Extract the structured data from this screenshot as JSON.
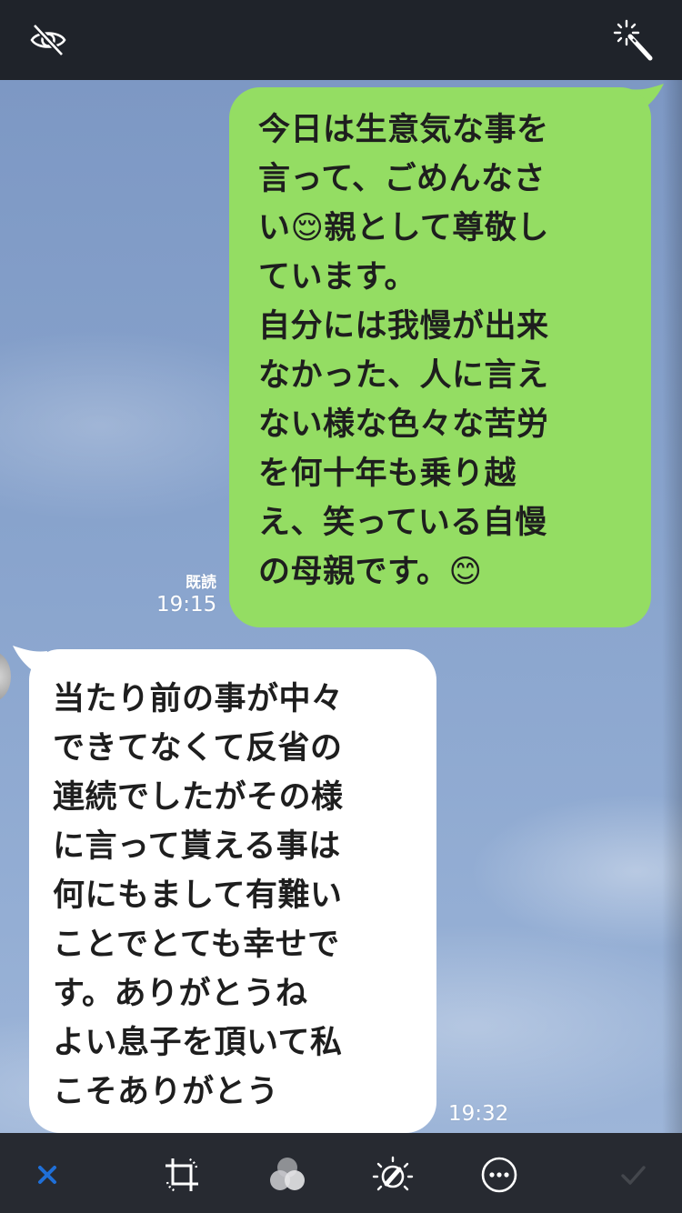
{
  "toolbar_top": {
    "hide_icon": "eye-slash-icon",
    "enhance_icon": "magic-wand-icon"
  },
  "chat": {
    "outgoing": {
      "text": "今日は生意気な事を\n言って、ごめんなさ\nい😌親として尊敬し\nています。\n自分には我慢が出来\nなかった、人に言え\nない様な色々な苦労\nを何十年も乗り越\nえ、笑っている自慢\nの母親です。😊",
      "read_label": "既読",
      "time": "19:15",
      "color": "#94dd63"
    },
    "incoming": {
      "text": "当たり前の事が中々\nできてなくて反省の\n連続でしたがその様\nに言って貰える事は\n何にもまして有難い\nことでとても幸せで\nす。ありがとうね\nよい息子を頂いて私\nこそありがとう",
      "time": "19:32",
      "color": "#ffffff"
    }
  },
  "toolbar_bottom": {
    "accent_color": "#1f6fd8",
    "tools": [
      "close-icon",
      "crop-rotate-icon",
      "filters-icon",
      "adjust-icon",
      "more-icon",
      "checkmark-icon"
    ]
  }
}
